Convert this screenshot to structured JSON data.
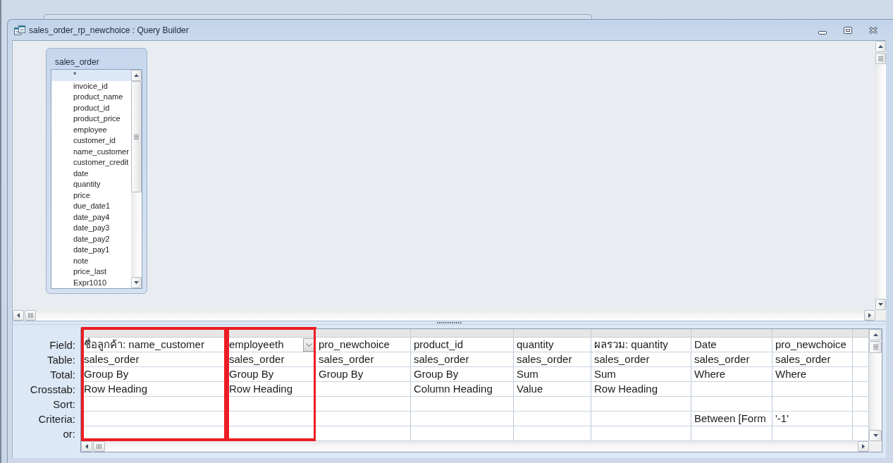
{
  "window": {
    "title": "sales_order_rp_newchoice : Query Builder"
  },
  "table_box": {
    "title": "sales_order",
    "fields": [
      {
        "name": "*",
        "selected": true
      },
      {
        "name": "invoice_id",
        "selected": false
      },
      {
        "name": "product_name",
        "selected": false
      },
      {
        "name": "product_id",
        "selected": false
      },
      {
        "name": "product_price",
        "selected": false
      },
      {
        "name": "employee",
        "selected": false
      },
      {
        "name": "customer_id",
        "selected": false
      },
      {
        "name": "name_customer",
        "selected": false
      },
      {
        "name": "customer_credit",
        "selected": false
      },
      {
        "name": "date",
        "selected": false
      },
      {
        "name": "quantity",
        "selected": false
      },
      {
        "name": "price",
        "selected": false
      },
      {
        "name": "due_date1",
        "selected": false
      },
      {
        "name": "date_pay4",
        "selected": false
      },
      {
        "name": "date_pay3",
        "selected": false
      },
      {
        "name": "date_pay2",
        "selected": false
      },
      {
        "name": "date_pay1",
        "selected": false
      },
      {
        "name": "note",
        "selected": false
      },
      {
        "name": "price_last",
        "selected": false
      },
      {
        "name": "Expr1010",
        "selected": false
      }
    ]
  },
  "grid": {
    "row_labels": [
      "Field:",
      "Table:",
      "Total:",
      "Crosstab:",
      "Sort:",
      "Criteria:",
      "or:"
    ],
    "columns": [
      {
        "highlighted": true,
        "active": false,
        "field": "ชื่อลูกค้า: name_customer",
        "table": "sales_order",
        "total": "Group By",
        "crosstab": "Row Heading"
      },
      {
        "highlighted": true,
        "active": true,
        "field": "employeeth",
        "table": "sales_order",
        "total": "Group By",
        "crosstab": "Row Heading"
      },
      {
        "highlighted": false,
        "active": false,
        "field": "pro_newchoice",
        "table": "sales_order",
        "total": "Group By"
      },
      {
        "highlighted": false,
        "active": false,
        "field": "product_id",
        "table": "sales_order",
        "total": "Group By",
        "crosstab": "Column Heading"
      },
      {
        "highlighted": false,
        "active": false,
        "field": "quantity",
        "table": "sales_order",
        "total": "Sum",
        "crosstab": "Value"
      },
      {
        "highlighted": false,
        "active": false,
        "field": "ผลรวม: quantity",
        "table": "sales_order",
        "total": "Sum",
        "crosstab": "Row Heading"
      },
      {
        "highlighted": false,
        "active": false,
        "field": "Date",
        "table": "sales_order",
        "total": "Where",
        "criteria": "Between [Form"
      },
      {
        "highlighted": false,
        "active": false,
        "field": "pro_newchoice",
        "table": "sales_order",
        "total": "Where",
        "criteria": "'-1'"
      }
    ]
  }
}
